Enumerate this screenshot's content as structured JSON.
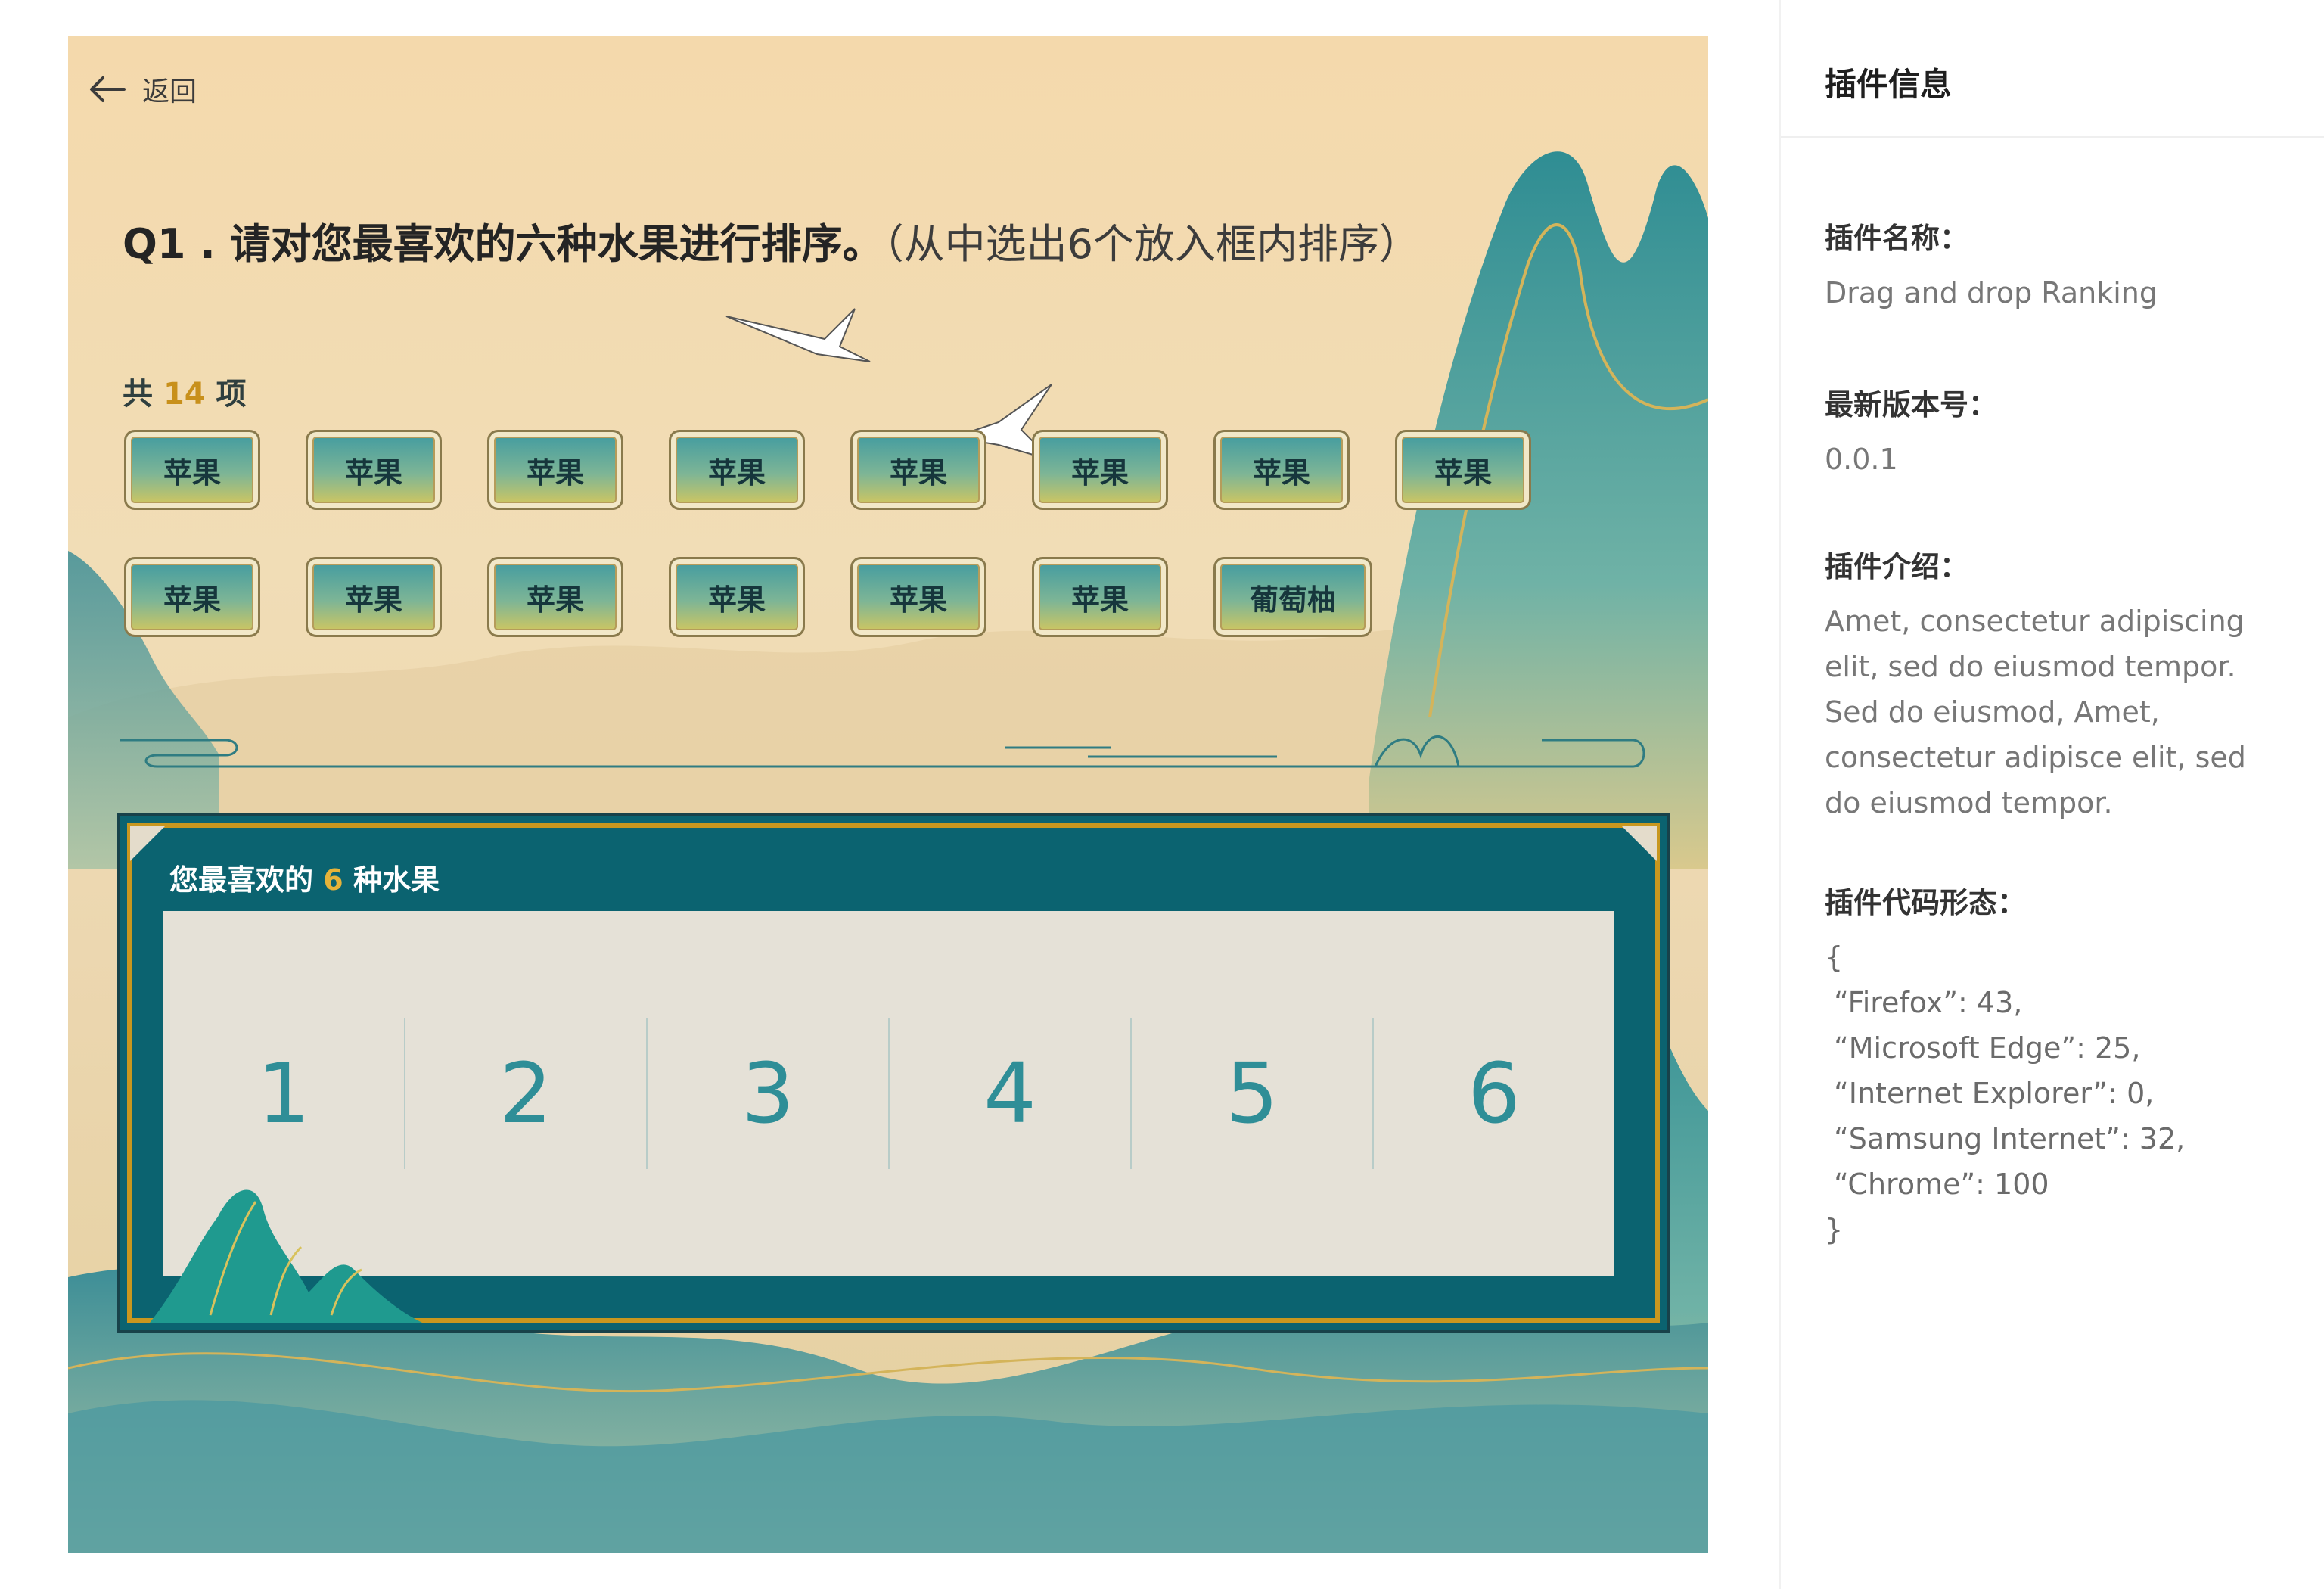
{
  "stage": {
    "back_label": "返回",
    "question_prefix": "Q1 . 请对您最喜欢的六种水果进行排序。",
    "question_hint": "（从中选出6个放入框内排序）",
    "count_prefix": "共",
    "count_value": "14",
    "count_suffix": "项",
    "items": [
      "苹果",
      "苹果",
      "苹果",
      "苹果",
      "苹果",
      "苹果",
      "苹果",
      "苹果",
      "苹果",
      "苹果",
      "苹果",
      "苹果",
      "苹果",
      "葡萄柚"
    ],
    "rank_title_prefix": "您最喜欢的",
    "rank_title_num": "6",
    "rank_title_suffix": "种水果",
    "slots": [
      "1",
      "2",
      "3",
      "4",
      "5",
      "6"
    ]
  },
  "panel": {
    "title": "插件信息",
    "name_label": "插件名称：",
    "name_value": "Drag and drop Ranking",
    "version_label": "最新版本号：",
    "version_value": "0.0.1",
    "intro_label": "插件介绍：",
    "intro_value": "Amet, consectetur adipiscing elit, sed do eiusmod tempor. Sed do eiusmod, Amet, consectetur adipisce elit, sed do eiusmod tempor.",
    "code_label": "插件代码形态：",
    "code_lines": [
      "{",
      " “Firefox”: 43,",
      " “Microsoft Edge”: 25,",
      " “Internet Explorer”: 0,",
      " “Samsung Internet”: 32,",
      " “Chrome”: 100",
      "}"
    ]
  },
  "colors": {
    "teal": "#0b6370",
    "gold": "#c8971f",
    "slot_number": "#2f8e97"
  }
}
